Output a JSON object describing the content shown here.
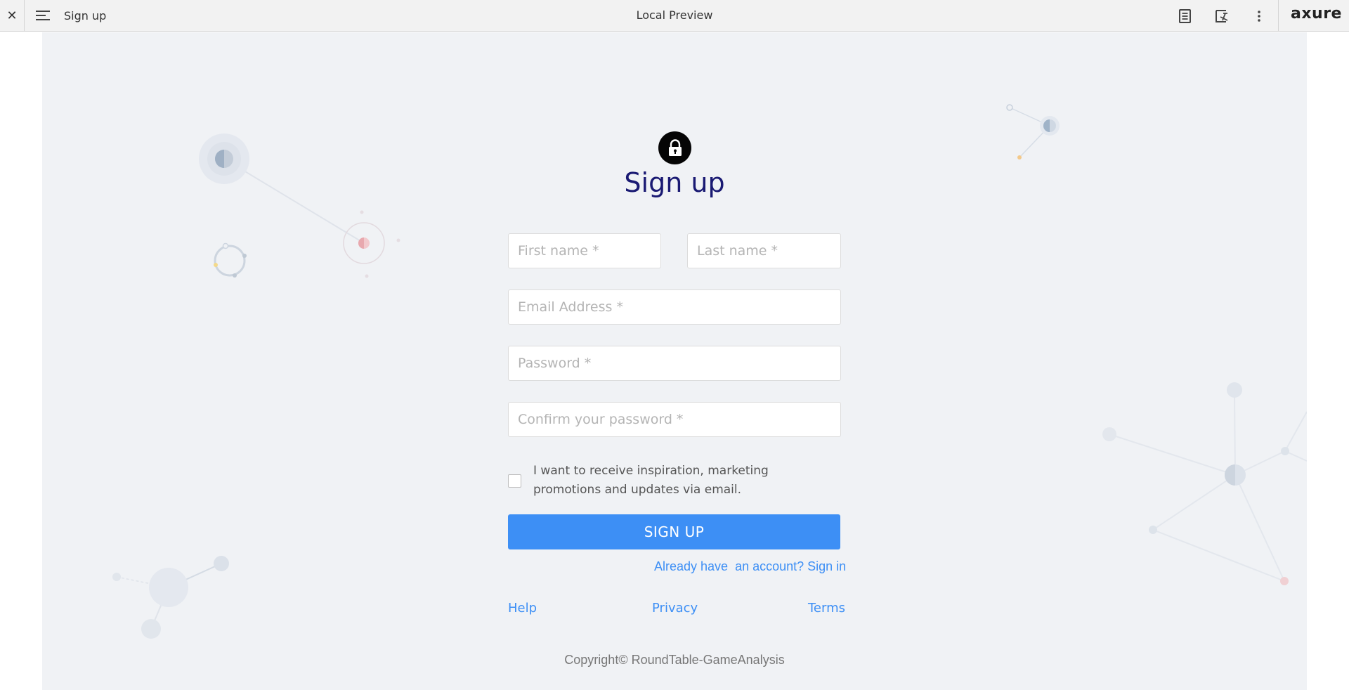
{
  "topbar": {
    "close_glyph": "✕",
    "page_name": "Sign up",
    "title": "Local Preview",
    "brand": "axure",
    "icons": [
      "close-icon",
      "hamburger-menu-icon",
      "notes-icon",
      "inspect-icon",
      "more-vertical-icon"
    ]
  },
  "form": {
    "title": "Sign up",
    "first_name_placeholder": "First name *",
    "last_name_placeholder": "Last name *",
    "email_placeholder": "Email Address *",
    "password_placeholder": "Password *",
    "confirm_placeholder": "Confirm your password *",
    "checkbox_checked": false,
    "checkbox_label": "I want to receive inspiration, marketing promotions and updates via email.",
    "submit_label": "SIGN UP",
    "signin_text": "Already have  an account? Sign in"
  },
  "footer": {
    "help": "Help",
    "privacy": "Privacy",
    "terms": "Terms",
    "copyright": "Copyright© RoundTable-GameAnalysis"
  },
  "colors": {
    "accent": "#3d8ff5",
    "heading": "#1a1a73",
    "canvas_bg": "#f0f2f5",
    "topbar_bg": "#f2f2f2"
  }
}
